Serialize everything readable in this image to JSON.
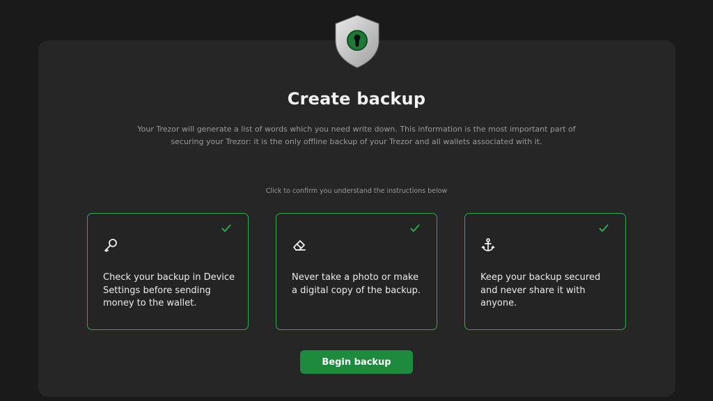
{
  "header": {
    "shield_icon": "shield-lock-icon",
    "title": "Create backup",
    "description": "Your Trezor will generate a list of words which you need write down. This information is the most important part of securing your Trezor: it is the only offline backup of your Trezor and all wallets associated with it."
  },
  "instructions": {
    "hint": "Click to confirm you understand the instructions below",
    "items": [
      {
        "icon": "key-icon",
        "text": "Check your backup in Device Settings before sending money to the wallet.",
        "checked": true
      },
      {
        "icon": "eraser-icon",
        "text": "Never take a photo or make a digital copy of the backup.",
        "checked": true
      },
      {
        "icon": "anchor-icon",
        "text": "Keep your backup secured and never share it with anyone.",
        "checked": true
      }
    ]
  },
  "actions": {
    "begin_label": "Begin backup"
  },
  "colors": {
    "background": "#1a1a1a",
    "card": "#262626",
    "accent": "#2fa84f",
    "button": "#1e8a3d"
  }
}
